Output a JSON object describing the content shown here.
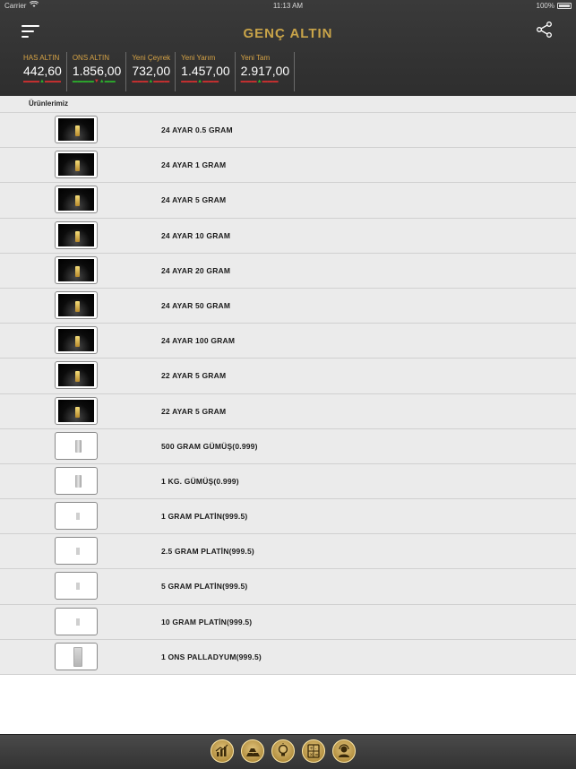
{
  "status_bar": {
    "carrier": "Carrier",
    "time": "11:13 AM",
    "battery": "100%"
  },
  "header": {
    "title": "GENÇ ALTIN",
    "accent_color": "#c9a449"
  },
  "prices": [
    {
      "name": "HAS ALTIN",
      "value": "442,60"
    },
    {
      "name": "ONS ALTIN",
      "value": "1.856,00"
    },
    {
      "name": "Yeni Çeyrek",
      "value": "732,00"
    },
    {
      "name": "Yeni Yarım",
      "value": "1.457,00"
    },
    {
      "name": "Yeni Tam",
      "value": "2.917,00"
    }
  ],
  "section": {
    "title": "Ürünlerimiz"
  },
  "products": [
    {
      "label": "24 AYAR 0.5 GRAM",
      "thumb": "gold"
    },
    {
      "label": "24 AYAR 1 GRAM",
      "thumb": "gold"
    },
    {
      "label": "24 AYAR 5 GRAM",
      "thumb": "gold"
    },
    {
      "label": "24 AYAR 10 GRAM",
      "thumb": "gold"
    },
    {
      "label": "24 AYAR 20 GRAM",
      "thumb": "gold"
    },
    {
      "label": "24 AYAR 50 GRAM",
      "thumb": "gold"
    },
    {
      "label": "24 AYAR 100 GRAM",
      "thumb": "gold"
    },
    {
      "label": "22 AYAR 5 GRAM",
      "thumb": "gold"
    },
    {
      "label": "22 AYAR 5 GRAM",
      "thumb": "gold"
    },
    {
      "label": "500 GRAM GÜMÜŞ(0.999)",
      "thumb": "silver"
    },
    {
      "label": "1 KG. GÜMÜŞ(0.999)",
      "thumb": "silver"
    },
    {
      "label": "1 GRAM PLATİN(999.5)",
      "thumb": "platin"
    },
    {
      "label": "2.5 GRAM PLATİN(999.5)",
      "thumb": "platin"
    },
    {
      "label": "5 GRAM PLATİN(999.5)",
      "thumb": "platin"
    },
    {
      "label": "10 GRAM PLATİN(999.5)",
      "thumb": "platin"
    },
    {
      "label": "1 ONS PALLADYUM(999.5)",
      "thumb": "pallad"
    }
  ],
  "tabbar": [
    {
      "icon": "chart-icon"
    },
    {
      "icon": "gold-bars-icon"
    },
    {
      "icon": "lightbulb-icon"
    },
    {
      "icon": "calculator-icon"
    },
    {
      "icon": "support-agent-icon"
    }
  ]
}
